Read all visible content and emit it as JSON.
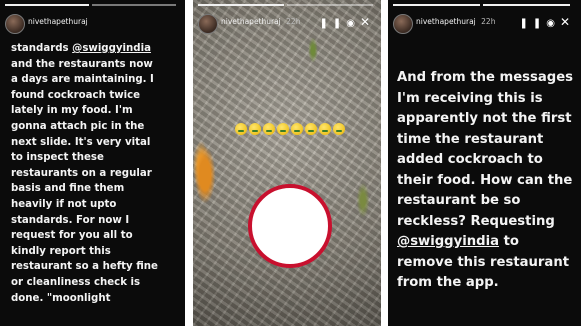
{
  "panels": [
    {
      "username": "nivethapethuraj",
      "time": "",
      "text_lines": [
        [
          "standards ",
          {
            "u": "@swiggyindia"
          }
        ],
        [
          "and the restaurants now"
        ],
        [
          "a days are maintaining. I"
        ],
        [
          "found cockroach twice"
        ],
        [
          "lately in my food. I'm"
        ],
        [
          "gonna attach pic in the"
        ],
        [
          "next slide. It's very vital"
        ],
        [
          "to inspect these"
        ],
        [
          "restaurants on a regular"
        ],
        [
          "basis and fine them"
        ],
        [
          "heavily if not upto"
        ],
        [
          "standards. For now I"
        ],
        [
          "request for you all to"
        ],
        [
          "kindly report this"
        ],
        [
          "restaurant so a hefty fine"
        ],
        [
          "or cleanliness check is"
        ],
        [
          "done. \"moonlight"
        ]
      ]
    },
    {
      "username": "nivethapethuraj",
      "time": "22h",
      "emoji_count": 8
    },
    {
      "username": "nivethapethuraj",
      "time": "22h",
      "text_lines": [
        [
          "And from the messages"
        ],
        [
          "I'm receiving this is"
        ],
        [
          "apparently not the first"
        ],
        [
          "time the restaurant"
        ],
        [
          "added cockroach to"
        ],
        [
          "their food. How can the"
        ],
        [
          "restaurant be so"
        ],
        [
          "reckless? Requesting"
        ],
        [
          {
            "u": "@swiggyindia"
          },
          " to"
        ],
        [
          "remove this restaurant"
        ],
        [
          "from the app."
        ]
      ]
    }
  ],
  "colors": {
    "accent_red": "#c8102e",
    "text": "#f4f4f4",
    "panel_bg": "#0b0b0b"
  },
  "icons": [
    "pause-icon",
    "mute-icon",
    "close-icon"
  ]
}
